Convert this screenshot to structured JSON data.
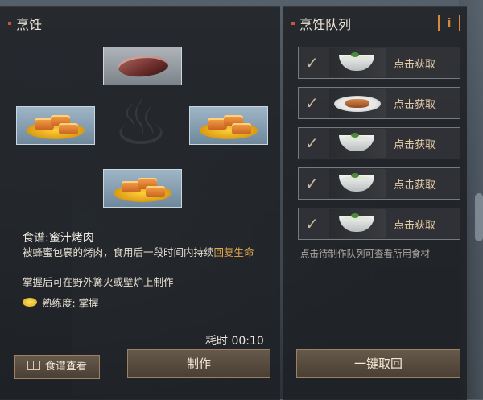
{
  "left_panel": {
    "title": "烹饪",
    "ingredients": [
      {
        "slot": "top",
        "item": "raw-meat"
      },
      {
        "slot": "left",
        "item": "honey-roast-meat"
      },
      {
        "slot": "right",
        "item": "honey-roast-meat"
      },
      {
        "slot": "bottom",
        "item": "honey-roast-meat"
      }
    ],
    "recipe": {
      "title": "食谱:蜜汁烤肉",
      "desc_normal": "被蜂蜜包裹的烤肉，食用后一段时间内持续",
      "desc_highlight": "回复生命",
      "extra": "掌握后可在野外篝火或壁炉上制作",
      "mastery": "熟练度: 掌握"
    },
    "time": "耗时 00:10",
    "buttons": {
      "recipe_view": "食谱查看",
      "make": "制作"
    }
  },
  "right_panel": {
    "title": "烹饪队列",
    "info_label": "i",
    "queue": [
      {
        "label": "点击获取",
        "dish": "herb-soup-bowl"
      },
      {
        "label": "点击获取",
        "dish": "meat-plate"
      },
      {
        "label": "点击获取",
        "dish": "porridge-bowl"
      },
      {
        "label": "点击获取",
        "dish": "porridge-bowl"
      },
      {
        "label": "点击获取",
        "dish": "porridge-bowl"
      }
    ],
    "hint": "点击待制作队列可查看所用食材",
    "collect_all": "一键取回"
  },
  "colors": {
    "accent_orange": "#d78a3a",
    "highlight_text": "#e3a849",
    "slot_blue": "#8ea8bb"
  }
}
